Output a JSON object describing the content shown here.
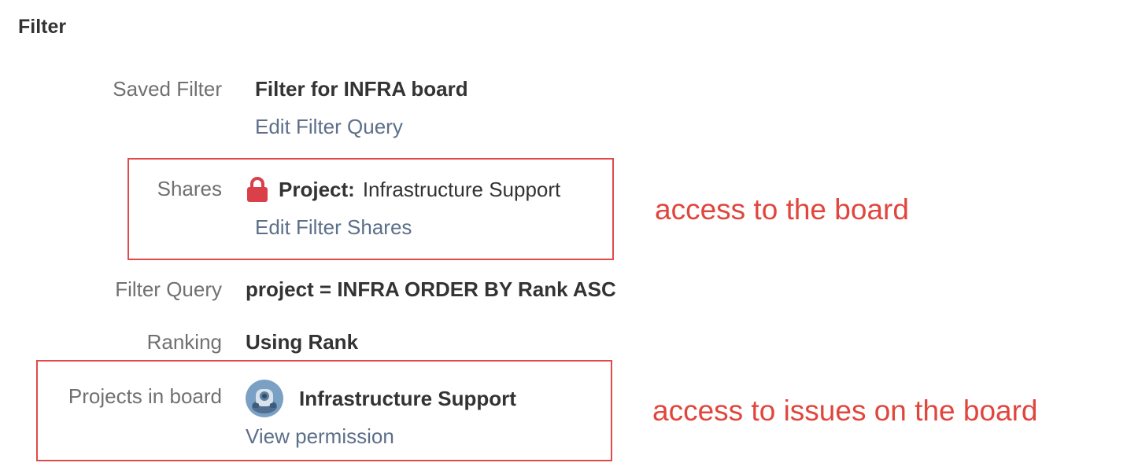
{
  "section": {
    "title": "Filter"
  },
  "saved_filter": {
    "label": "Saved Filter",
    "value": "Filter for INFRA board",
    "edit_link": "Edit Filter Query"
  },
  "shares": {
    "label": "Shares",
    "icon": "lock-icon",
    "kind": "Project:",
    "name": "Infrastructure Support",
    "edit_link": "Edit Filter Shares"
  },
  "filter_query": {
    "label": "Filter Query",
    "value": "project = INFRA ORDER BY Rank ASC"
  },
  "ranking": {
    "label": "Ranking",
    "value": "Using Rank"
  },
  "projects_in_board": {
    "label": "Projects in board",
    "avatar_icon": "project-avatar-icon",
    "name": "Infrastructure Support",
    "view_link": "View permission"
  },
  "annotations": {
    "shares_note": "access to the board",
    "projects_note": "access to issues on the board"
  },
  "colors": {
    "annotation": "#e04a4a",
    "lock": "#d9404a",
    "link": "#5d6f89",
    "label": "#707070"
  }
}
